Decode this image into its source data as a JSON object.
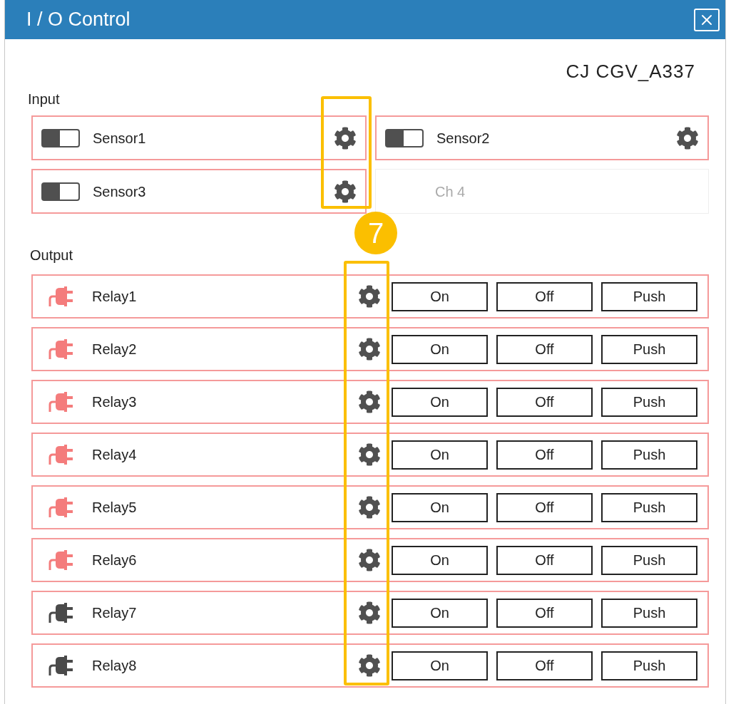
{
  "window": {
    "title": "I / O Control"
  },
  "device": "CJ CGV_A337",
  "input": {
    "label": "Input",
    "channels": [
      {
        "name": "Sensor1",
        "on": false,
        "disabled": false
      },
      {
        "name": "Sensor2",
        "on": false,
        "disabled": false
      },
      {
        "name": "Sensor3",
        "on": false,
        "disabled": false
      },
      {
        "name": "Ch 4",
        "disabled": true
      }
    ]
  },
  "output": {
    "label": "Output",
    "relays": [
      {
        "name": "Relay1",
        "active": true,
        "buttons": [
          "On",
          "Off",
          "Push"
        ]
      },
      {
        "name": "Relay2",
        "active": true,
        "buttons": [
          "On",
          "Off",
          "Push"
        ]
      },
      {
        "name": "Relay3",
        "active": true,
        "buttons": [
          "On",
          "Off",
          "Push"
        ]
      },
      {
        "name": "Relay4",
        "active": true,
        "buttons": [
          "On",
          "Off",
          "Push"
        ]
      },
      {
        "name": "Relay5",
        "active": true,
        "buttons": [
          "On",
          "Off",
          "Push"
        ]
      },
      {
        "name": "Relay6",
        "active": true,
        "buttons": [
          "On",
          "Off",
          "Push"
        ]
      },
      {
        "name": "Relay7",
        "active": false,
        "buttons": [
          "On",
          "Off",
          "Push"
        ]
      },
      {
        "name": "Relay8",
        "active": false,
        "buttons": [
          "On",
          "Off",
          "Push"
        ]
      }
    ]
  },
  "annotation": {
    "badge": "7"
  }
}
